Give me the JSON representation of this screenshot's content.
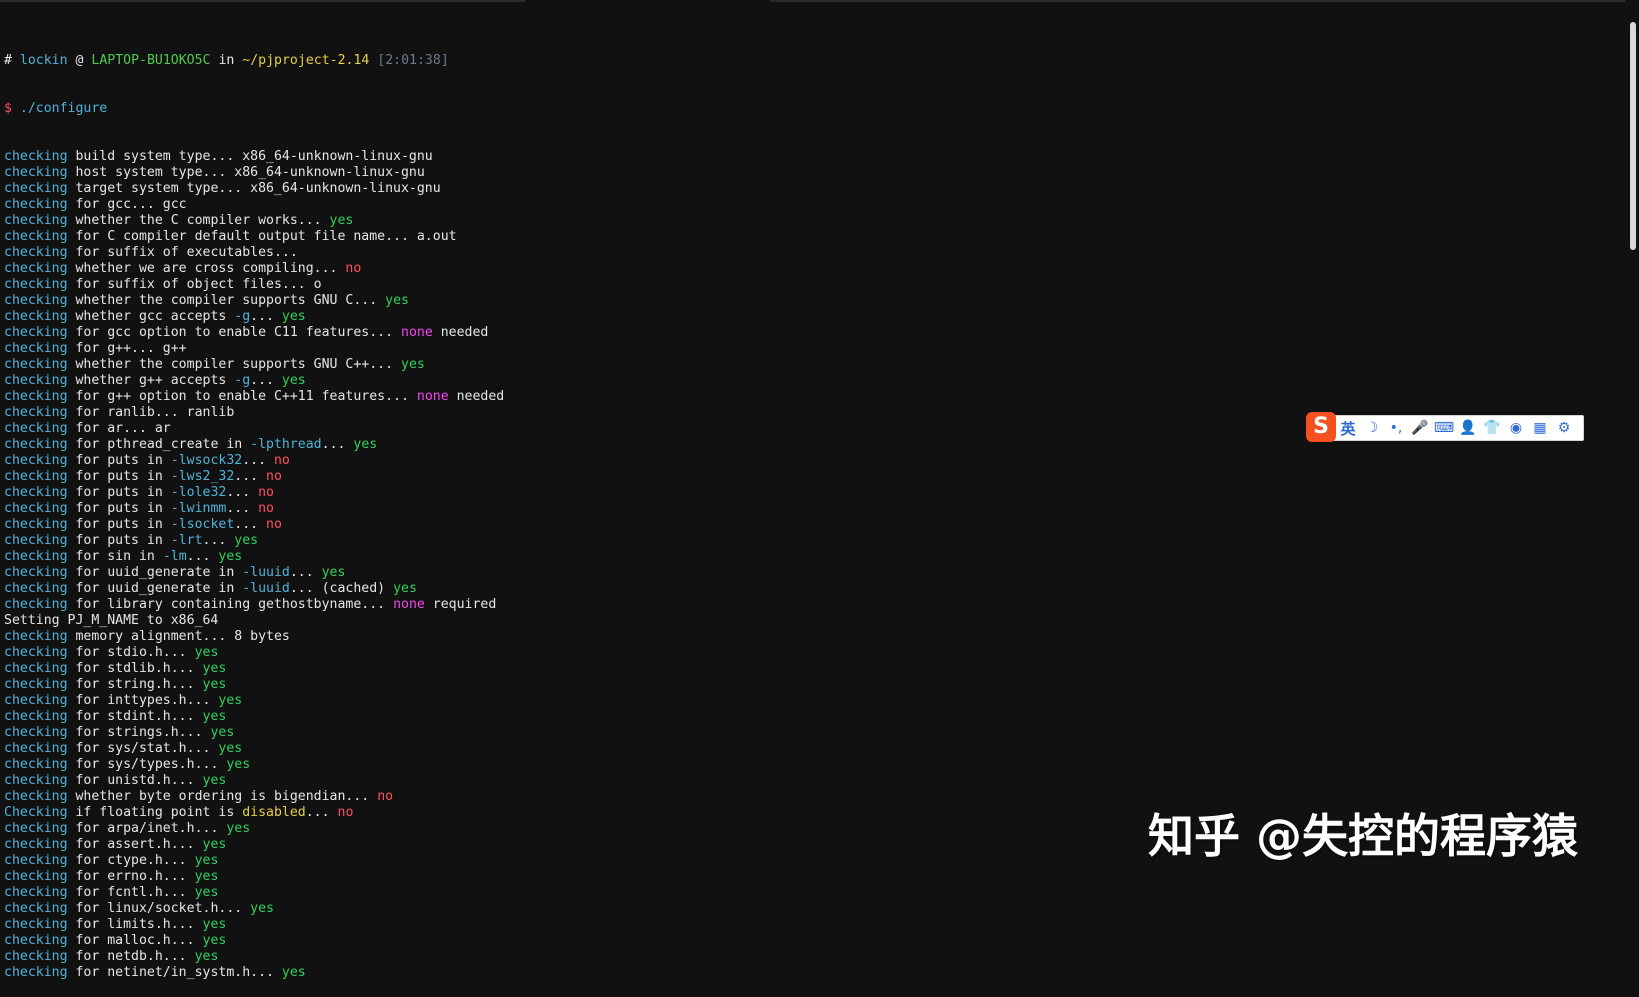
{
  "prompt": {
    "hash": "#",
    "user": "lockin",
    "at": "@",
    "host": "LAPTOP-BU1OKO5C",
    "in": "in",
    "path": "~/pjproject-2.14",
    "time": "[2:01:38]"
  },
  "command": {
    "dollar": "$",
    "text": "./configure"
  },
  "output_lines": [
    [
      [
        "kw",
        "checking"
      ],
      [
        "plain",
        " build system type... x86_64-unknown-linux-gnu"
      ]
    ],
    [
      [
        "kw",
        "checking"
      ],
      [
        "plain",
        " host system type... x86_64-unknown-linux-gnu"
      ]
    ],
    [
      [
        "kw",
        "checking"
      ],
      [
        "plain",
        " target system type... x86_64-unknown-linux-gnu"
      ]
    ],
    [
      [
        "kw",
        "checking"
      ],
      [
        "plain",
        " for gcc... gcc"
      ]
    ],
    [
      [
        "kw",
        "checking"
      ],
      [
        "plain",
        " whether the C compiler works... "
      ],
      [
        "yes",
        "yes"
      ]
    ],
    [
      [
        "kw",
        "checking"
      ],
      [
        "plain",
        " for C compiler default output file name... a.out"
      ]
    ],
    [
      [
        "kw",
        "checking"
      ],
      [
        "plain",
        " for suffix of executables..."
      ]
    ],
    [
      [
        "kw",
        "checking"
      ],
      [
        "plain",
        " whether we are cross compiling... "
      ],
      [
        "no",
        "no"
      ]
    ],
    [
      [
        "kw",
        "checking"
      ],
      [
        "plain",
        " for suffix of object files... o"
      ]
    ],
    [
      [
        "kw",
        "checking"
      ],
      [
        "plain",
        " whether the compiler supports GNU C... "
      ],
      [
        "yes",
        "yes"
      ]
    ],
    [
      [
        "kw",
        "checking"
      ],
      [
        "plain",
        " whether gcc accepts "
      ],
      [
        "flag",
        "-g"
      ],
      [
        "plain",
        "... "
      ],
      [
        "yes",
        "yes"
      ]
    ],
    [
      [
        "kw",
        "checking"
      ],
      [
        "plain",
        " for gcc option to enable C11 features... "
      ],
      [
        "none",
        "none"
      ],
      [
        "plain",
        " needed"
      ]
    ],
    [
      [
        "kw",
        "checking"
      ],
      [
        "plain",
        " for g++... g++"
      ]
    ],
    [
      [
        "kw",
        "checking"
      ],
      [
        "plain",
        " whether the compiler supports GNU C++... "
      ],
      [
        "yes",
        "yes"
      ]
    ],
    [
      [
        "kw",
        "checking"
      ],
      [
        "plain",
        " whether g++ accepts "
      ],
      [
        "flag",
        "-g"
      ],
      [
        "plain",
        "... "
      ],
      [
        "yes",
        "yes"
      ]
    ],
    [
      [
        "kw",
        "checking"
      ],
      [
        "plain",
        " for g++ option to enable C++11 features... "
      ],
      [
        "none",
        "none"
      ],
      [
        "plain",
        " needed"
      ]
    ],
    [
      [
        "kw",
        "checking"
      ],
      [
        "plain",
        " for ranlib... ranlib"
      ]
    ],
    [
      [
        "kw",
        "checking"
      ],
      [
        "plain",
        " for ar... ar"
      ]
    ],
    [
      [
        "kw",
        "checking"
      ],
      [
        "plain",
        " for pthread_create in "
      ],
      [
        "flag",
        "-lpthread"
      ],
      [
        "plain",
        "... "
      ],
      [
        "yes",
        "yes"
      ]
    ],
    [
      [
        "kw",
        "checking"
      ],
      [
        "plain",
        " for puts in "
      ],
      [
        "flag",
        "-lwsock32"
      ],
      [
        "plain",
        "... "
      ],
      [
        "no",
        "no"
      ]
    ],
    [
      [
        "kw",
        "checking"
      ],
      [
        "plain",
        " for puts in "
      ],
      [
        "flag",
        "-lws2_32"
      ],
      [
        "plain",
        "... "
      ],
      [
        "no",
        "no"
      ]
    ],
    [
      [
        "kw",
        "checking"
      ],
      [
        "plain",
        " for puts in "
      ],
      [
        "flag",
        "-lole32"
      ],
      [
        "plain",
        "... "
      ],
      [
        "no",
        "no"
      ]
    ],
    [
      [
        "kw",
        "checking"
      ],
      [
        "plain",
        " for puts in "
      ],
      [
        "flag",
        "-lwinmm"
      ],
      [
        "plain",
        "... "
      ],
      [
        "no",
        "no"
      ]
    ],
    [
      [
        "kw",
        "checking"
      ],
      [
        "plain",
        " for puts in "
      ],
      [
        "flag",
        "-lsocket"
      ],
      [
        "plain",
        "... "
      ],
      [
        "no",
        "no"
      ]
    ],
    [
      [
        "kw",
        "checking"
      ],
      [
        "plain",
        " for puts in "
      ],
      [
        "flag",
        "-lrt"
      ],
      [
        "plain",
        "... "
      ],
      [
        "yes",
        "yes"
      ]
    ],
    [
      [
        "kw",
        "checking"
      ],
      [
        "plain",
        " for sin in "
      ],
      [
        "flag",
        "-lm"
      ],
      [
        "plain",
        "... "
      ],
      [
        "yes",
        "yes"
      ]
    ],
    [
      [
        "kw",
        "checking"
      ],
      [
        "plain",
        " for uuid_generate in "
      ],
      [
        "flag",
        "-luuid"
      ],
      [
        "plain",
        "... "
      ],
      [
        "yes",
        "yes"
      ]
    ],
    [
      [
        "kw",
        "checking"
      ],
      [
        "plain",
        " for uuid_generate in "
      ],
      [
        "flag",
        "-luuid"
      ],
      [
        "plain",
        "... (cached) "
      ],
      [
        "yes",
        "yes"
      ]
    ],
    [
      [
        "kw",
        "checking"
      ],
      [
        "plain",
        " for library containing gethostbyname... "
      ],
      [
        "none",
        "none"
      ],
      [
        "plain",
        " required"
      ]
    ],
    [
      [
        "plain",
        "Setting PJ_M_NAME to x86_64"
      ]
    ],
    [
      [
        "kw",
        "checking"
      ],
      [
        "plain",
        " memory alignment... 8 bytes"
      ]
    ],
    [
      [
        "kw",
        "checking"
      ],
      [
        "plain",
        " for stdio.h... "
      ],
      [
        "yes",
        "yes"
      ]
    ],
    [
      [
        "kw",
        "checking"
      ],
      [
        "plain",
        " for stdlib.h... "
      ],
      [
        "yes",
        "yes"
      ]
    ],
    [
      [
        "kw",
        "checking"
      ],
      [
        "plain",
        " for string.h... "
      ],
      [
        "yes",
        "yes"
      ]
    ],
    [
      [
        "kw",
        "checking"
      ],
      [
        "plain",
        " for inttypes.h... "
      ],
      [
        "yes",
        "yes"
      ]
    ],
    [
      [
        "kw",
        "checking"
      ],
      [
        "plain",
        " for stdint.h... "
      ],
      [
        "yes",
        "yes"
      ]
    ],
    [
      [
        "kw",
        "checking"
      ],
      [
        "plain",
        " for strings.h... "
      ],
      [
        "yes",
        "yes"
      ]
    ],
    [
      [
        "kw",
        "checking"
      ],
      [
        "plain",
        " for sys/stat.h... "
      ],
      [
        "yes",
        "yes"
      ]
    ],
    [
      [
        "kw",
        "checking"
      ],
      [
        "plain",
        " for sys/types.h... "
      ],
      [
        "yes",
        "yes"
      ]
    ],
    [
      [
        "kw",
        "checking"
      ],
      [
        "plain",
        " for unistd.h... "
      ],
      [
        "yes",
        "yes"
      ]
    ],
    [
      [
        "kw",
        "checking"
      ],
      [
        "plain",
        " whether byte ordering is bigendian... "
      ],
      [
        "no",
        "no"
      ]
    ],
    [
      [
        "kw",
        "Checking"
      ],
      [
        "plain",
        " if floating point is "
      ],
      [
        "yellow",
        "disabled"
      ],
      [
        "plain",
        "... "
      ],
      [
        "no",
        "no"
      ]
    ],
    [
      [
        "kw",
        "checking"
      ],
      [
        "plain",
        " for arpa/inet.h... "
      ],
      [
        "yes",
        "yes"
      ]
    ],
    [
      [
        "kw",
        "checking"
      ],
      [
        "plain",
        " for assert.h... "
      ],
      [
        "yes",
        "yes"
      ]
    ],
    [
      [
        "kw",
        "checking"
      ],
      [
        "plain",
        " for ctype.h... "
      ],
      [
        "yes",
        "yes"
      ]
    ],
    [
      [
        "kw",
        "checking"
      ],
      [
        "plain",
        " for errno.h... "
      ],
      [
        "yes",
        "yes"
      ]
    ],
    [
      [
        "kw",
        "checking"
      ],
      [
        "plain",
        " for fcntl.h... "
      ],
      [
        "yes",
        "yes"
      ]
    ],
    [
      [
        "kw",
        "checking"
      ],
      [
        "plain",
        " for linux/socket.h... "
      ],
      [
        "yes",
        "yes"
      ]
    ],
    [
      [
        "kw",
        "checking"
      ],
      [
        "plain",
        " for limits.h... "
      ],
      [
        "yes",
        "yes"
      ]
    ],
    [
      [
        "kw",
        "checking"
      ],
      [
        "plain",
        " for malloc.h... "
      ],
      [
        "yes",
        "yes"
      ]
    ],
    [
      [
        "kw",
        "checking"
      ],
      [
        "plain",
        " for netdb.h... "
      ],
      [
        "yes",
        "yes"
      ]
    ],
    [
      [
        "kw",
        "checking"
      ],
      [
        "plain",
        " for netinet/in_systm.h... "
      ],
      [
        "yes",
        "yes"
      ]
    ]
  ],
  "ime_toolbar": {
    "logo": "S",
    "mode": "英",
    "icons": [
      {
        "name": "moon-icon",
        "glyph": "☽"
      },
      {
        "name": "punctuation-icon",
        "glyph": "•,"
      },
      {
        "name": "microphone-icon",
        "glyph": "🎤"
      },
      {
        "name": "keyboard-icon",
        "glyph": "⌨"
      },
      {
        "name": "person-icon",
        "glyph": "👤"
      },
      {
        "name": "shirt-icon",
        "glyph": "👕"
      },
      {
        "name": "robot-icon",
        "glyph": "◉"
      },
      {
        "name": "grid-icon",
        "glyph": "▦"
      },
      {
        "name": "gear-icon",
        "glyph": "⚙"
      }
    ]
  },
  "watermark": "知乎 @失控的程序猿",
  "colors": {
    "background": "#111111",
    "keyword": "#4fb3d9",
    "yes": "#34d15b",
    "no": "#ff4f5e",
    "none": "#ef48ef",
    "disabled": "#e5d047",
    "user": "#4fb3d9",
    "host": "#4ec94e",
    "path": "#e5d047",
    "time": "#6a7a8c"
  }
}
